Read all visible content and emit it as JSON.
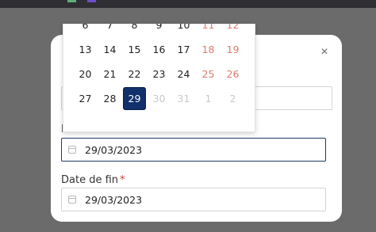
{
  "colors": {
    "overlay": "#6b6b6b",
    "selected_day_bg": "#12306b",
    "weekend_text": "#e07b6c",
    "required_marker": "#d23b3b",
    "focus_border": "#1f3a66"
  },
  "modal": {
    "close_icon": "×",
    "start_date": {
      "label": "Date de début",
      "value": "29/03/2023"
    },
    "end_date": {
      "label": "Date de fin",
      "required_marker": "*",
      "value": "29/03/2023"
    }
  },
  "calendar": {
    "selected": "29",
    "weeks": [
      [
        {
          "d": "6",
          "t": "normal"
        },
        {
          "d": "7",
          "t": "normal"
        },
        {
          "d": "8",
          "t": "normal"
        },
        {
          "d": "9",
          "t": "normal"
        },
        {
          "d": "10",
          "t": "normal"
        },
        {
          "d": "11",
          "t": "weekend"
        },
        {
          "d": "12",
          "t": "weekend"
        }
      ],
      [
        {
          "d": "13",
          "t": "normal"
        },
        {
          "d": "14",
          "t": "normal"
        },
        {
          "d": "15",
          "t": "normal"
        },
        {
          "d": "16",
          "t": "normal"
        },
        {
          "d": "17",
          "t": "normal"
        },
        {
          "d": "18",
          "t": "weekend"
        },
        {
          "d": "19",
          "t": "weekend"
        }
      ],
      [
        {
          "d": "20",
          "t": "normal"
        },
        {
          "d": "21",
          "t": "normal"
        },
        {
          "d": "22",
          "t": "normal"
        },
        {
          "d": "23",
          "t": "normal"
        },
        {
          "d": "24",
          "t": "normal"
        },
        {
          "d": "25",
          "t": "weekend"
        },
        {
          "d": "26",
          "t": "weekend"
        }
      ],
      [
        {
          "d": "27",
          "t": "normal"
        },
        {
          "d": "28",
          "t": "normal"
        },
        {
          "d": "29",
          "t": "selected"
        },
        {
          "d": "30",
          "t": "muted"
        },
        {
          "d": "31",
          "t": "muted"
        },
        {
          "d": "1",
          "t": "muted"
        },
        {
          "d": "2",
          "t": "muted"
        }
      ]
    ]
  }
}
